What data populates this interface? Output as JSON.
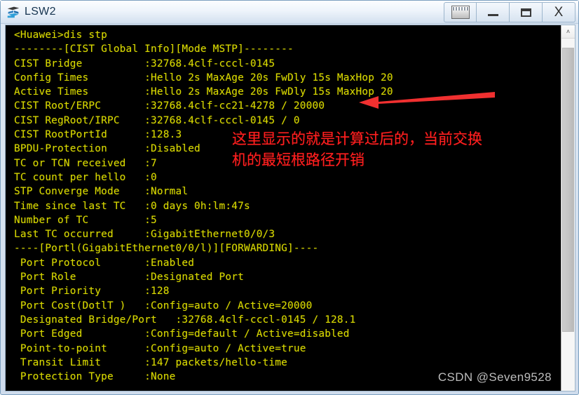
{
  "window": {
    "title": "LSW2",
    "icon": "switch-icon",
    "controls": [
      {
        "name": "restore-window-button",
        "glyph": "restore-icon",
        "label": ""
      },
      {
        "name": "minimize-window-button",
        "glyph": "minimize-icon",
        "label": ""
      },
      {
        "name": "maximize-window-button",
        "glyph": "maximize-icon",
        "label": ""
      },
      {
        "name": "close-window-button",
        "glyph": "close-icon",
        "label": "X"
      }
    ]
  },
  "terminal": {
    "foreground_color": "#d8d800",
    "background_color": "#000000",
    "lines": [
      "<Huawei>dis stp",
      "--------[CIST Global Info][Mode MSTP]--------",
      "CIST Bridge          :32768.4clf-cccl-0145",
      "Config Times         :Hello 2s MaxAge 20s FwDly 15s MaxHop 20",
      "Active Times         :Hello 2s MaxAge 20s FwDly 15s MaxHop 20",
      "CIST Root/ERPC       :32768.4clf-cc21-4278 / 20000",
      "CIST RegRoot/IRPC    :32768.4clf-cccl-0145 / 0",
      "CIST RootPortId      :128.3",
      "BPDU-Protection      :Disabled",
      "TC or TCN received   :7",
      "TC count per hello   :0",
      "STP Converge Mode    :Normal",
      "Time since last TC   :0 days 0h:lm:47s",
      "Number of TC         :5",
      "Last TC occurred     :GigabitEthernet0/0/3",
      "----[Portl(GigabitEthernet0/0/l)][FORWARDING]----",
      " Port Protocol       :Enabled",
      " Port Role           :Designated Port",
      " Port Priority       :128",
      " Port Cost(DotlT )   :Config=auto / Active=20000",
      " Designated Bridge/Port   :32768.4clf-cccl-0145 / 128.1",
      " Port Edged          :Config=default / Active=disabled",
      " Point-to-point      :Config=auto / Active=true",
      " Transit Limit       :147 packets/hello-time",
      " Protection Type     :None"
    ]
  },
  "scrollbar": {
    "up_arrow_glyph": "˄"
  },
  "annotations": {
    "note_text": "这里显示的就是计算过后的，当前交换\n机的最短根路径开销",
    "note_color": "#ff2020",
    "arrow_color": "#f03030",
    "arrow_direction": "left"
  },
  "watermark": {
    "text": "CSDN @Seven9528"
  }
}
